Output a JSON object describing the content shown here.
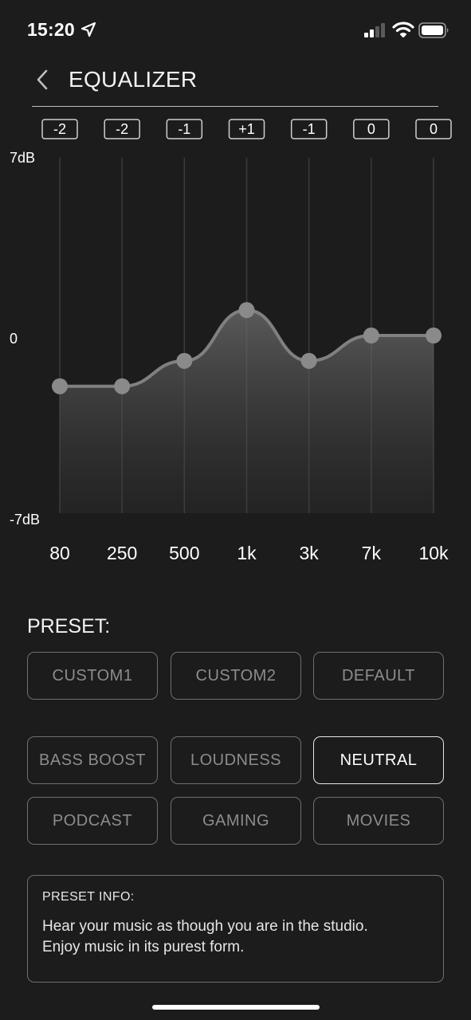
{
  "status_bar": {
    "time": "15:20",
    "icons": [
      "location-arrow-icon",
      "cellular-signal-icon",
      "wifi-icon",
      "battery-icon"
    ]
  },
  "nav": {
    "title": "EQUALIZER",
    "back_icon": "chevron-left-icon"
  },
  "chart_data": {
    "type": "line",
    "x": [
      "80",
      "250",
      "500",
      "1k",
      "3k",
      "7k",
      "10k"
    ],
    "series": [
      {
        "values": [
          -2,
          -2,
          -1,
          1,
          -1,
          0,
          0
        ]
      }
    ],
    "value_labels": [
      "-2",
      "-2",
      "-1",
      "+1",
      "-1",
      "0",
      "0"
    ],
    "y_ticks": [
      "7dB",
      "0",
      "-7dB"
    ],
    "ylim": [
      -7,
      7
    ],
    "title": "",
    "xlabel": "",
    "ylabel": "",
    "grid": "vertical",
    "fill": "area-gradient",
    "colors": {
      "line": "#808080",
      "point": "#8a8a8a",
      "grid": "#3c3c3c",
      "label_box": "#cfcfcf"
    }
  },
  "presets": {
    "heading": "PRESET:",
    "rows": [
      [
        "CUSTOM1",
        "CUSTOM2",
        "DEFAULT"
      ],
      [
        "BASS BOOST",
        "LOUDNESS",
        "NEUTRAL"
      ],
      [
        "PODCAST",
        "GAMING",
        "MOVIES"
      ]
    ],
    "selected": "NEUTRAL"
  },
  "info": {
    "title": "PRESET INFO:",
    "text_line1": "Hear your music as though you are in the studio.",
    "text_line2": "Enjoy music in its purest form."
  },
  "colors": {
    "background": "#1c1c1c",
    "text": "#ffffff",
    "muted": "#8c8c8c",
    "border": "#6f6f6f"
  }
}
